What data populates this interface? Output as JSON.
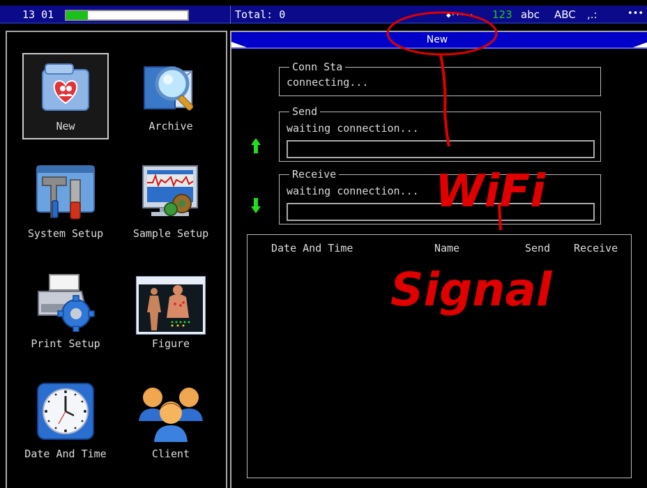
{
  "status_bar": {
    "time": "13 01",
    "battery_level": 0.18,
    "total": "Total: 0",
    "wifi_dots": "◆·····",
    "mode_123": "123",
    "mode_abc": "abc",
    "mode_ABC": "ABC",
    "mode_punct": ",.:",
    "more": "•••"
  },
  "sidebar": {
    "items": [
      {
        "label": "New",
        "icon": "new-record-icon"
      },
      {
        "label": "Archive",
        "icon": "archive-search-icon"
      },
      {
        "label": "System Setup",
        "icon": "system-setup-tools-icon"
      },
      {
        "label": "Sample Setup",
        "icon": "sample-setup-monitor-icon"
      },
      {
        "label": "Print Setup",
        "icon": "printer-gear-icon"
      },
      {
        "label": "Figure",
        "icon": "body-figure-icon"
      },
      {
        "label": "Date And Time",
        "icon": "clock-icon"
      },
      {
        "label": "Client",
        "icon": "users-group-icon"
      }
    ]
  },
  "panel": {
    "title": "New",
    "conn_group": {
      "legend": "Conn Sta",
      "value": "connecting..."
    },
    "send_group": {
      "legend": "Send",
      "value": "waiting connection..."
    },
    "receive_group": {
      "legend": "Receive",
      "value": "waiting connection..."
    },
    "table": {
      "columns": [
        "Date And Time",
        "Name",
        "Send",
        "Receive"
      ]
    }
  },
  "annotations": {
    "text1": "WiFi",
    "text2": "Signal"
  },
  "colors": {
    "status_blue": "#0a0a8a",
    "title_blue": "#0000c8",
    "battery_green": "#19c119",
    "arrow_green": "#22dd22",
    "annotation_red": "#e00000"
  }
}
